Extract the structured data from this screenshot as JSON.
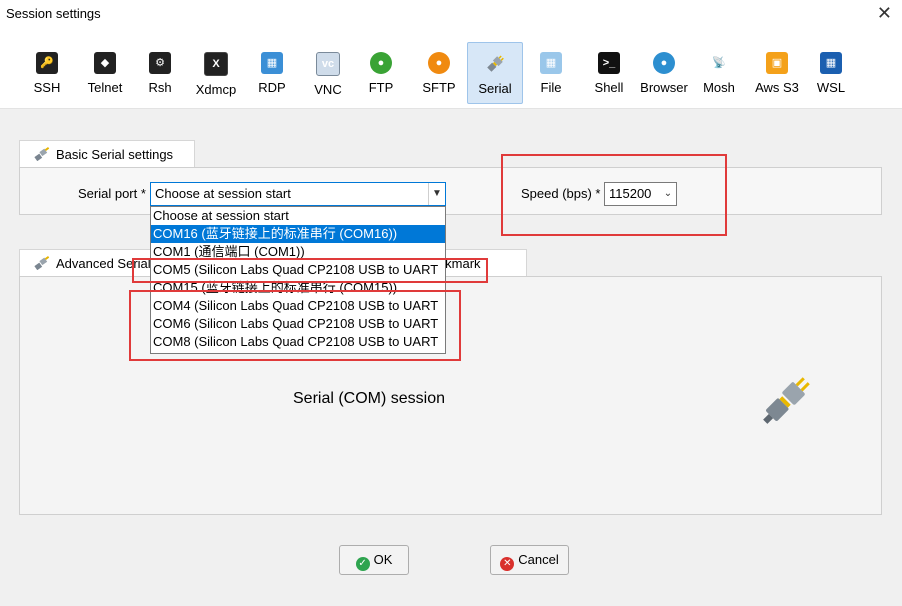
{
  "window": {
    "title": "Session settings",
    "close_glyph": "✕"
  },
  "toolbar": {
    "items": [
      {
        "label": "SSH",
        "icon": "ssh-key-icon"
      },
      {
        "label": "Telnet",
        "icon": "telnet-icon"
      },
      {
        "label": "Rsh",
        "icon": "rsh-icon"
      },
      {
        "label": "Xdmcp",
        "icon": "xdmcp-icon"
      },
      {
        "label": "RDP",
        "icon": "rdp-icon"
      },
      {
        "label": "VNC",
        "icon": "vnc-icon"
      },
      {
        "label": "FTP",
        "icon": "ftp-globe-icon"
      },
      {
        "label": "SFTP",
        "icon": "sftp-globe-icon"
      },
      {
        "label": "Serial",
        "icon": "serial-plug-icon",
        "active": true
      },
      {
        "label": "File",
        "icon": "file-icon"
      },
      {
        "label": "Shell",
        "icon": "shell-terminal-icon"
      },
      {
        "label": "Browser",
        "icon": "browser-globe-icon"
      },
      {
        "label": "Mosh",
        "icon": "mosh-dish-icon"
      },
      {
        "label": "Aws S3",
        "icon": "aws-s3-cubes-icon"
      },
      {
        "label": "WSL",
        "icon": "wsl-windows-icon"
      }
    ]
  },
  "basic": {
    "tab_label": "Basic Serial settings",
    "serial_port_label": "Serial port *",
    "serial_port_value": "Choose at session start",
    "speed_label": "Speed (bps) *",
    "speed_value": "115200",
    "port_options": [
      {
        "label": "Choose at session start"
      },
      {
        "label": "COM16  (蓝牙链接上的标准串行 (COM16))",
        "selected": true
      },
      {
        "label": "COM1  (通信端口 (COM1))"
      },
      {
        "label": "COM5  (Silicon Labs Quad CP2108 USB to UART"
      },
      {
        "label": "COM15  (蓝牙链接上的标准串行 (COM15))"
      },
      {
        "label": "COM4  (Silicon Labs Quad CP2108 USB to UART"
      },
      {
        "label": "COM6  (Silicon Labs Quad CP2108 USB to UART"
      },
      {
        "label": "COM8  (Silicon Labs Quad CP2108 USB to UART"
      }
    ]
  },
  "advanced": {
    "tab_label_left": "Advanced Serial settings",
    "tab_label_right": "Bookmark settings",
    "session_text": "Serial (COM) session"
  },
  "buttons": {
    "ok": "OK",
    "cancel": "Cancel"
  },
  "colors": {
    "accent": "#0078d7",
    "highlight_red": "#e03a3a",
    "ok_green": "#2ea44f",
    "cancel_red": "#d9302c"
  }
}
